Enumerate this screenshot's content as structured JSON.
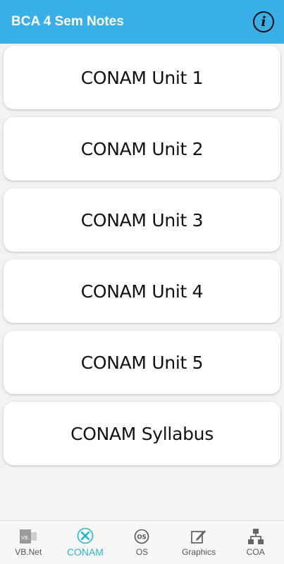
{
  "app_bar": {
    "title": "BCA 4 Sem Notes",
    "info_icon": "info-icon",
    "info_glyph": "i",
    "color": "#3aaee7"
  },
  "cards": [
    {
      "label": "CONAM Unit 1"
    },
    {
      "label": "CONAM Unit 2"
    },
    {
      "label": "CONAM Unit 3"
    },
    {
      "label": "CONAM Unit 4"
    },
    {
      "label": "CONAM Unit 5"
    },
    {
      "label": "CONAM Syllabus"
    }
  ],
  "bottom_nav": {
    "active_color": "#2bb6c9",
    "items": [
      {
        "label": "VB.Net",
        "icon": "vbnet-icon",
        "icon_text": "VB."
      },
      {
        "label": "CONAM",
        "icon": "conam-icon",
        "active": true
      },
      {
        "label": "OS",
        "icon": "os-icon",
        "icon_text": "OS"
      },
      {
        "label": "Graphics",
        "icon": "graphics-icon"
      },
      {
        "label": "COA",
        "icon": "coa-icon"
      }
    ]
  }
}
